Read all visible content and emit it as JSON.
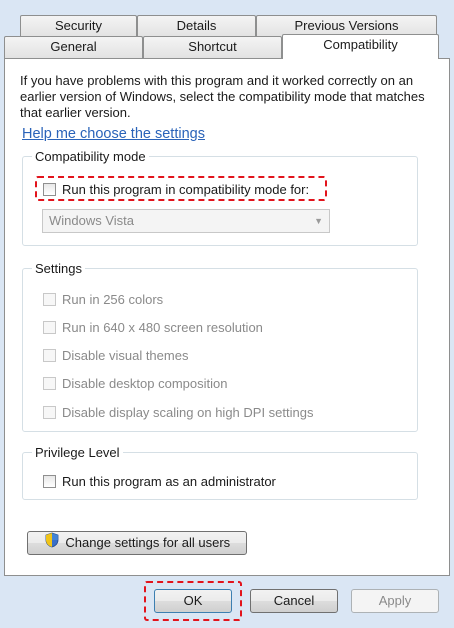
{
  "tabs_back": [
    "Security",
    "Details",
    "Previous Versions"
  ],
  "tabs_front": [
    "General",
    "Shortcut",
    "Compatibility"
  ],
  "description": "If you have problems with this program and it worked correctly on an earlier version of Windows, select the compatibility mode that matches that earlier version.",
  "help_link": "Help me choose the settings",
  "compat_mode": {
    "title": "Compatibility mode",
    "checkbox_label": "Run this program in compatibility mode for:",
    "selected_os": "Windows Vista"
  },
  "settings": {
    "title": "Settings",
    "items": [
      "Run in 256 colors",
      "Run in 640 x 480 screen resolution",
      "Disable visual themes",
      "Disable desktop composition",
      "Disable display scaling on high DPI settings"
    ]
  },
  "privilege": {
    "title": "Privilege Level",
    "checkbox_label": "Run this program as an administrator"
  },
  "change_settings_label": "Change settings for all users",
  "buttons": {
    "ok": "OK",
    "cancel": "Cancel",
    "apply": "Apply"
  },
  "colors": {
    "highlight": "#e2141c",
    "link": "#2a63b9",
    "background": "#dae6f4"
  },
  "icons": [
    "shield-icon",
    "chevron-down-icon"
  ]
}
